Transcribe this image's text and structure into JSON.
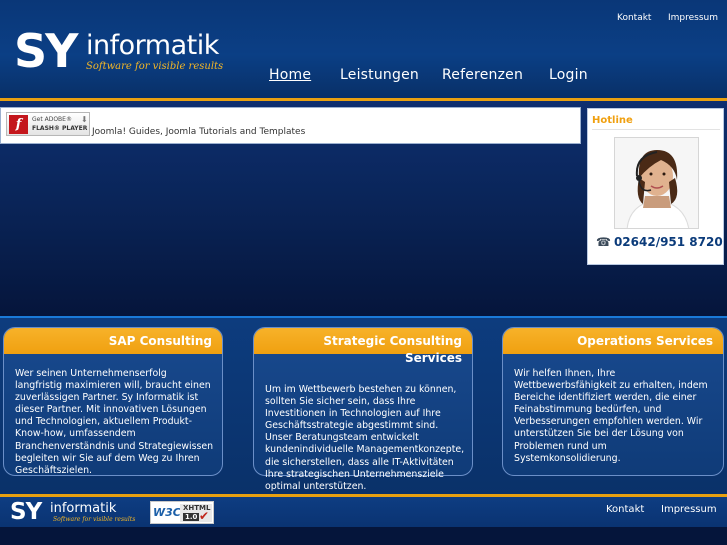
{
  "brand": {
    "logo_main": "SY",
    "logo_name": "informatik",
    "tagline": "Software for visible results"
  },
  "top_links": {
    "kontakt": "Kontakt",
    "impressum": "Impressum"
  },
  "nav": {
    "home": "Home",
    "leistungen": "Leistungen",
    "referenzen": "Referenzen",
    "login": "Login"
  },
  "flash": {
    "badge_get": "Get ADOBE®",
    "badge_player": "FLASH® PLAYER",
    "alt_text": "Joomla! Guides, Joomla Tutorials and Templates"
  },
  "hotline": {
    "title": "Hotline",
    "phone": "02642/951 8720"
  },
  "cards": [
    {
      "title": "SAP Consulting",
      "body": "Wer seinen Unternehmenserfolg langfristig maximieren will, braucht einen zuverlässigen Partner. Sy Informatik ist dieser Partner. Mit innovativen Lösungen und Technologien, aktuellem Produkt-Know-how, umfassendem Branchenverständnis und Strategiewissen begleiten wir Sie auf dem Weg zu Ihren Geschäftszielen."
    },
    {
      "title": "Strategic Consulting Services",
      "body": "Um im Wettbewerb bestehen zu können, sollten Sie sicher sein, dass Ihre Investitionen in Technologien auf Ihre Geschäftsstrategie abgestimmt sind. Unser Beratungsteam entwickelt kundenindividuelle Managementkonzepte, die sicherstellen, dass alle IT-Aktivitäten Ihre strategischen Unternehmensziele optimal unterstützen."
    },
    {
      "title": "Operations Services",
      "body": "Wir helfen Ihnen, Ihre Wettbewerbsfähigkeit zu erhalten, indem Bereiche identifiziert werden, die einer Feinabstimmung bedürfen, und Verbesserungen empfohlen werden. Wir unterstützen Sie bei der Lösung von Problemen rund um Systemkonsolidierung."
    }
  ],
  "footer": {
    "logo_main": "SY",
    "logo_name": "informatik",
    "tagline": "Software for visible results",
    "badge_w3c": "W3C",
    "badge_xhtml": "XHTML",
    "badge_version": "1.0",
    "kontakt": "Kontakt",
    "impressum": "Impressum"
  },
  "colors": {
    "accent": "#f0a010",
    "header_blue": "#0b3f85",
    "phone_blue": "#0b3b7a"
  },
  "icons": [
    "flash-player-icon",
    "download-arrow-icon",
    "phone-icon",
    "w3c-check-icon"
  ]
}
